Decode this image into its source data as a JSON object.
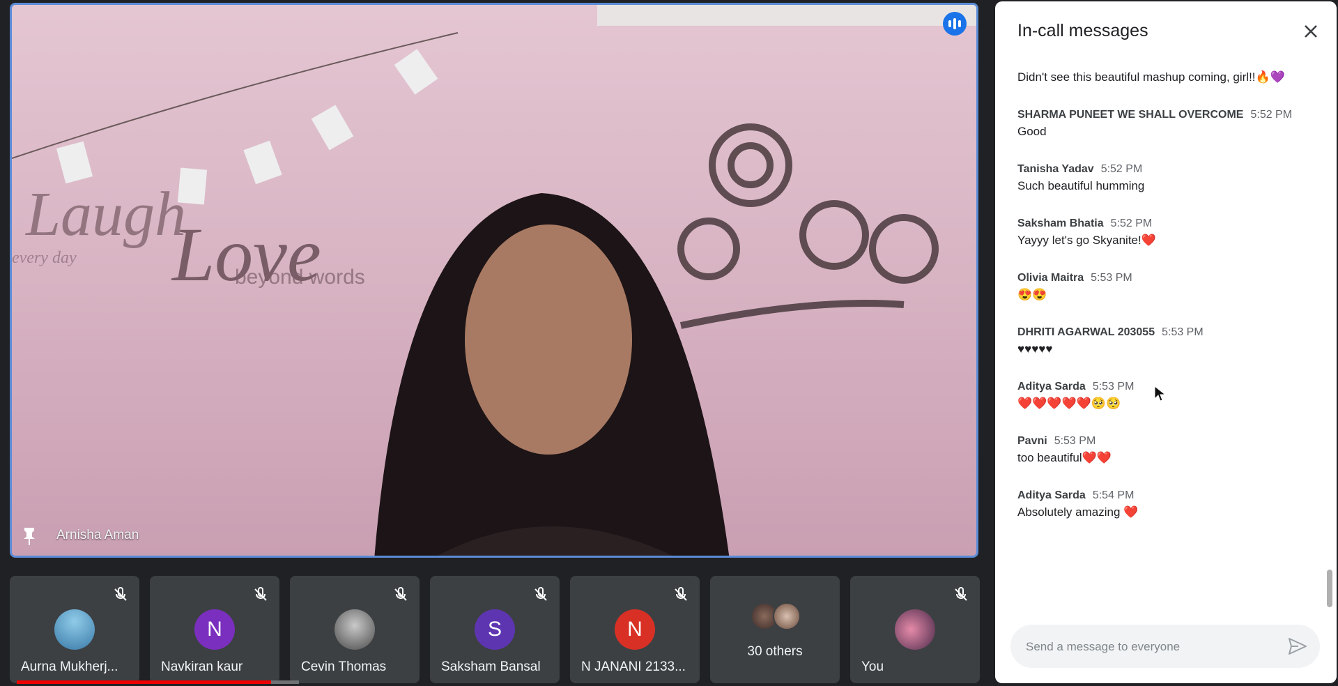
{
  "main_video": {
    "speaker_name": "Arnisha Aman",
    "wall_text_1": "Laugh",
    "wall_text_2": "Love",
    "wall_text_3": "beyond words",
    "wall_text_4": "every day"
  },
  "participants": [
    {
      "name": "Aurna Mukherj...",
      "avatar": "photo",
      "muted": true
    },
    {
      "name": "Navkiran kaur",
      "avatar": "N",
      "avatar_color": "#7b2fbe",
      "muted": true
    },
    {
      "name": "Cevin Thomas",
      "avatar": "photo",
      "muted": true
    },
    {
      "name": "Saksham Bansal",
      "avatar": "S",
      "avatar_color": "#5e35b1",
      "muted": true
    },
    {
      "name": "N JANANI 2133...",
      "avatar": "N",
      "avatar_color": "#d93025",
      "muted": true
    },
    {
      "name": "30 others",
      "avatar": "group-photos",
      "muted": false
    },
    {
      "name": "You",
      "avatar": "photo",
      "muted": true
    }
  ],
  "chat": {
    "title": "In-call messages",
    "composer_placeholder": "Send a message to everyone",
    "messages": [
      {
        "sender": "",
        "time": "",
        "text": "Didn't see this beautiful mashup coming, girl!!🔥💜"
      },
      {
        "sender": "SHARMA PUNEET WE SHALL OVERCOME",
        "time": "5:52 PM",
        "text": "Good"
      },
      {
        "sender": "Tanisha Yadav",
        "time": "5:52 PM",
        "text": "Such beautiful humming"
      },
      {
        "sender": "Saksham Bhatia",
        "time": "5:52 PM",
        "text": "Yayyy let's go Skyanite!❤️"
      },
      {
        "sender": "Olivia Maitra",
        "time": "5:53 PM",
        "text": "😍😍"
      },
      {
        "sender": "DHRITI AGARWAL 203055",
        "time": "5:53 PM",
        "text": "♥♥♥♥♥"
      },
      {
        "sender": "Aditya Sarda",
        "time": "5:53 PM",
        "text": "❤️❤️❤️❤️❤️🥺🥺"
      },
      {
        "sender": "Pavni",
        "time": "5:53 PM",
        "text": "too beautiful❤️❤️"
      },
      {
        "sender": "Aditya Sarda",
        "time": "5:54 PM",
        "text": "Absolutely amazing ❤️"
      }
    ]
  },
  "video_progress": 0.9,
  "colors": {
    "accent": "#1a73e8",
    "tile_bg": "#3c4043",
    "progress": "#ee0000"
  }
}
